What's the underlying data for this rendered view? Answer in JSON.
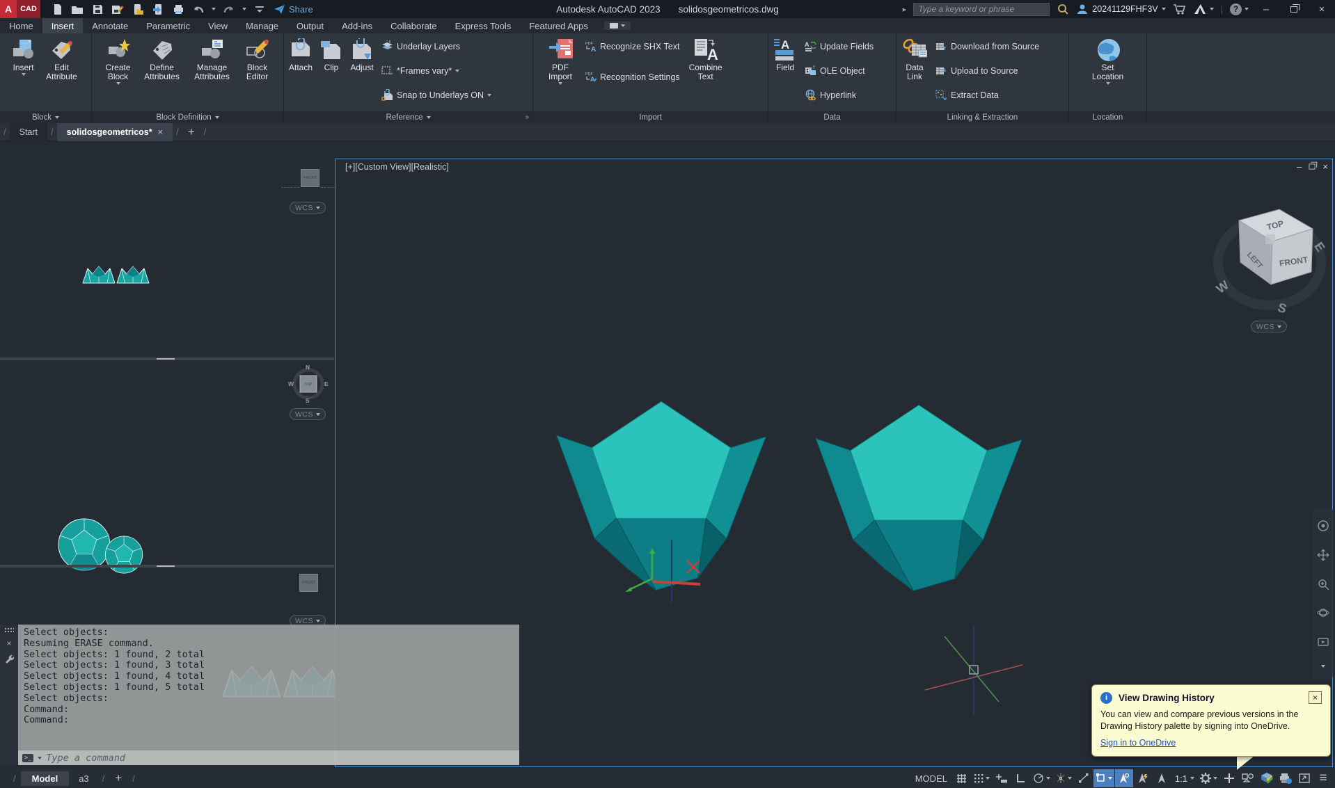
{
  "colors": {
    "teal_mid": "#17a6a1",
    "teal_light": "#2cc3bd",
    "teal_dark": "#0a6b74",
    "viewport_border": "#4e8fd0",
    "statusbar_highlight": "#4d7fbe",
    "notification_bg": "#fbfbd2",
    "pdf_red": "#e57272",
    "titlebar_bg": "#171b22",
    "ribbon_bg": "#30363e"
  },
  "icons": {
    "close": "×",
    "minimize": "–",
    "plus": "+",
    "hamburger": "≡",
    "expand_arrow": "▸",
    "help": "?",
    "slash": "/",
    "prompt": ">_",
    "info": "i",
    "letter_a": "A",
    "pdf_small": "PDF",
    "expand_panel": "»"
  },
  "titlebar": {
    "logo_a": "A",
    "logo_cad": "CAD",
    "share": "Share",
    "app_title": "Autodesk AutoCAD 2023",
    "doc_title": "solidosgeometricos.dwg",
    "search_placeholder": "Type a keyword or phrase",
    "username": "20241129FHF3V"
  },
  "ribbon_tabs": {
    "items": [
      "Home",
      "Insert",
      "Annotate",
      "Parametric",
      "View",
      "Manage",
      "Output",
      "Add-ins",
      "Collaborate",
      "Express Tools",
      "Featured Apps"
    ],
    "active": "Insert"
  },
  "ribbon": {
    "insert": "Insert",
    "edit_attribute": "Edit Attribute",
    "create_block": "Create Block",
    "define_attributes": "Define Attributes",
    "manage_attributes": "Manage Attributes",
    "block_editor": "Block Editor",
    "attach": "Attach",
    "clip": "Clip",
    "adjust": "Adjust",
    "underlay_layers": "Underlay Layers",
    "frames_vary": "*Frames vary*",
    "snap_to_underlays": "Snap to Underlays ON",
    "pdf_import": "PDF Import",
    "recognize_shx": "Recognize SHX Text",
    "recognition_settings": "Recognition Settings",
    "combine_text": "Combine Text",
    "field": "Field",
    "update_fields": "Update Fields",
    "ole_object": "OLE Object",
    "hyperlink": "Hyperlink",
    "data_link": "Data Link",
    "download_from_source": "Download from Source",
    "upload_to_source": "Upload to Source",
    "extract_data": "Extract Data",
    "set_location": "Set Location",
    "panel_block": "Block",
    "panel_block_definition": "Block Definition",
    "panel_reference": "Reference",
    "panel_import": "Import",
    "panel_data": "Data",
    "panel_linking": "Linking & Extraction",
    "panel_location": "Location"
  },
  "file_tabs": {
    "start": "Start",
    "document": "solidosgeometricos*"
  },
  "viewport": {
    "label": "[+][Custom View][Realistic]",
    "wcs": "WCS",
    "viewcube": {
      "top": "TOP",
      "front": "FRONT",
      "left": "LEFT",
      "w": "W",
      "s": "S",
      "e": "E"
    }
  },
  "left_viewports": {
    "vp1_wcs": "WCS",
    "vp2_wcs": "WCS",
    "vp3_wcs": "WCS",
    "vp1_cube": "FRONT",
    "vp2_cube": "TOP",
    "vp2_n": "N",
    "vp2_w": "W",
    "vp2_e": "E",
    "vp2_s": "S"
  },
  "command": {
    "lines": [
      "Select objects:",
      "Resuming ERASE command.",
      "Select objects: 1 found, 2 total",
      "Select objects: 1 found, 3 total",
      "Select objects: 1 found, 4 total",
      "Select objects: 1 found, 5 total",
      "Select objects:",
      "Command:",
      "Command:"
    ],
    "placeholder": "Type a command"
  },
  "statusbar": {
    "model_tab": "Model",
    "layout_tab": "a3",
    "model_space": "MODEL",
    "scale": "1:1"
  },
  "notification": {
    "title": "View Drawing History",
    "body": "You can view and compare previous versions in the Drawing History palette by signing into OneDrive.",
    "link": "Sign in to OneDrive"
  }
}
